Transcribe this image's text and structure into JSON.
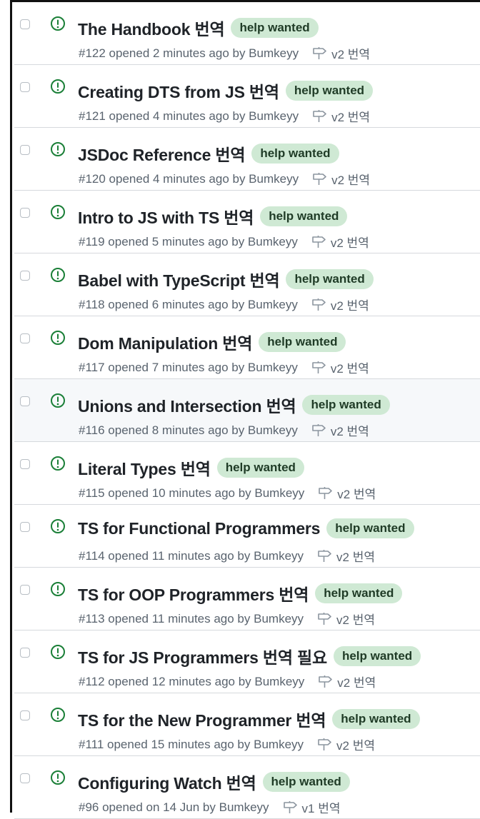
{
  "colors": {
    "open_issue": "#1a7f37",
    "label_bg": "#cfe9d4",
    "label_text": "#1f3b26",
    "meta_text": "#59636e",
    "row_hover": "#f6f8fa"
  },
  "icons": {
    "status": "issue-opened-icon",
    "milestone": "milestone-icon"
  },
  "issues": [
    {
      "title": "The Handbook 번역",
      "label": "help wanted",
      "meta": "#122 opened 2 minutes ago by Bumkeyy",
      "milestone": "v2 번역",
      "hovered": false
    },
    {
      "title": "Creating DTS from JS 번역",
      "label": "help wanted",
      "meta": "#121 opened 4 minutes ago by Bumkeyy",
      "milestone": "v2 번역",
      "hovered": false
    },
    {
      "title": "JSDoc Reference 번역",
      "label": "help wanted",
      "meta": "#120 opened 4 minutes ago by Bumkeyy",
      "milestone": "v2 번역",
      "hovered": false
    },
    {
      "title": "Intro to JS with TS 번역",
      "label": "help wanted",
      "meta": "#119 opened 5 minutes ago by Bumkeyy",
      "milestone": "v2 번역",
      "hovered": false
    },
    {
      "title": "Babel with TypeScript 번역",
      "label": "help wanted",
      "meta": "#118 opened 6 minutes ago by Bumkeyy",
      "milestone": "v2 번역",
      "hovered": false
    },
    {
      "title": "Dom Manipulation 번역",
      "label": "help wanted",
      "meta": "#117 opened 7 minutes ago by Bumkeyy",
      "milestone": "v2 번역",
      "hovered": false
    },
    {
      "title": "Unions and Intersection 번역",
      "label": "help wanted",
      "meta": "#116 opened 8 minutes ago by Bumkeyy",
      "milestone": "v2 번역",
      "hovered": true
    },
    {
      "title": "Literal Types 번역",
      "label": "help wanted",
      "meta": "#115 opened 10 minutes ago by Bumkeyy",
      "milestone": "v2 번역",
      "hovered": false
    },
    {
      "title": "TS for Functional Programmers",
      "label": "help wanted",
      "meta": "#114 opened 11 minutes ago by Bumkeyy",
      "milestone": "v2 번역",
      "hovered": false
    },
    {
      "title": "TS for OOP Programmers 번역",
      "label": "help wanted",
      "meta": "#113 opened 11 minutes ago by Bumkeyy",
      "milestone": "v2 번역",
      "hovered": false
    },
    {
      "title": "TS for JS Programmers 번역 필요",
      "label": "help wanted",
      "meta": "#112 opened 12 minutes ago by Bumkeyy",
      "milestone": "v2 번역",
      "hovered": false
    },
    {
      "title": "TS for the New Programmer 번역",
      "label": "help wanted",
      "meta": "#111 opened 15 minutes ago by Bumkeyy",
      "milestone": "v2 번역",
      "hovered": false
    },
    {
      "title": "Configuring Watch 번역",
      "label": "help wanted",
      "meta": "#96 opened on 14 Jun by Bumkeyy",
      "milestone": "v1 번역",
      "hovered": false
    }
  ]
}
